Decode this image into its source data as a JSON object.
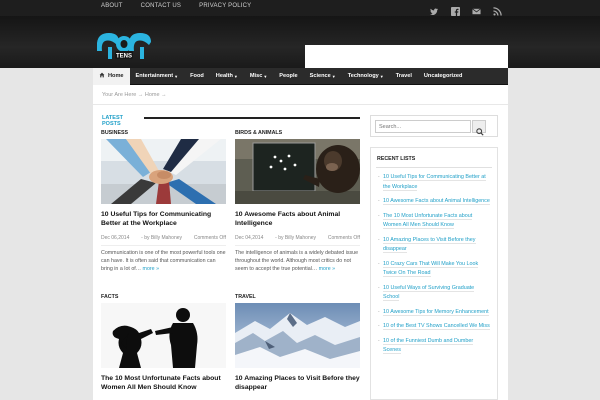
{
  "topbar": {
    "links": [
      "ABOUT",
      "CONTACT US",
      "PRIVACY POLICY"
    ]
  },
  "social_icons": [
    "twitter-icon",
    "facebook-icon",
    "email-icon",
    "rss-icon"
  ],
  "logo": {
    "text": "TENS"
  },
  "nav": {
    "items": [
      {
        "label": "Home",
        "dropdown": false
      },
      {
        "label": "Entertainment",
        "dropdown": true
      },
      {
        "label": "Food",
        "dropdown": false
      },
      {
        "label": "Health",
        "dropdown": true
      },
      {
        "label": "Misc",
        "dropdown": true
      },
      {
        "label": "People",
        "dropdown": false
      },
      {
        "label": "Science",
        "dropdown": true
      },
      {
        "label": "Technology",
        "dropdown": true
      },
      {
        "label": "Travel",
        "dropdown": false
      },
      {
        "label": "Uncategorized",
        "dropdown": false
      }
    ]
  },
  "breadcrumb": "Your Are Here → Home →",
  "latest_label": "LATEST POSTS",
  "posts": [
    {
      "category": "BUSINESS",
      "title": "10 Useful Tips for Communicating Better at the Workplace",
      "date": "Dec 06,2014",
      "author": "- by Billy Mahoney",
      "comments": "Comments Off",
      "excerpt": "Communication is one of the most powerful tools one can have. It is often said that communication can bring in a lot of…",
      "more": "more »"
    },
    {
      "category": "BIRDS & ANIMALS",
      "title": "10 Awesome Facts about Animal Intelligence",
      "date": "Dec 04,2014",
      "author": "- by Billy Mahoney",
      "comments": "Comments Off",
      "excerpt": "The intelligence of animals is a widely debated issue throughout the world. Although most critics do not seem to accept the true potential…",
      "more": "more »"
    },
    {
      "category": "FACTS",
      "title": "The 10 Most Unfortunate Facts about Women All Men Should Know"
    },
    {
      "category": "TRAVEL",
      "title": "10 Amazing Places to Visit Before they disappear"
    }
  ],
  "search": {
    "placeholder": "Search..."
  },
  "recent": {
    "title": "RECENT LISTS",
    "items": [
      "10 Useful Tips for Communicating Better at the Workplace",
      "10 Awesome Facts about Animal Intelligence",
      "The 10 Most Unfortunate Facts about Women All Men Should Know",
      "10 Amazing Places to Visit Before they disappear",
      "10 Crazy Cars That Will Make You Look Twice On The Road",
      "10 Useful Ways of Surviving Graduate School",
      "10 Awesome Tips for Memory Enhancement",
      "10 of the Best TV Shows Cancelled We Miss",
      "10 of the Funniest Dumb and Dumber Scenes"
    ]
  },
  "colors": {
    "accent": "#21a0c8",
    "nav_bg": "#2b2b2b",
    "header_bg": "#1e1e1e"
  }
}
